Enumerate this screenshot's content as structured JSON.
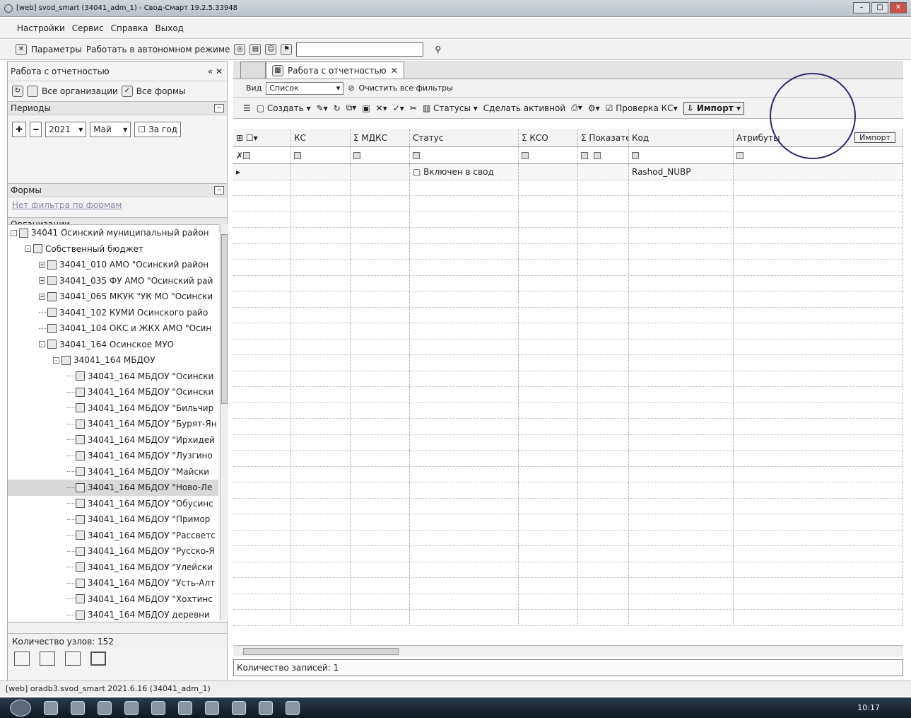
{
  "window": {
    "title": "[web] svod_smart (34041_adm_1) - Свод-Смарт 19.2.5.33948",
    "min": "–",
    "max": "□",
    "close": "✕"
  },
  "menu": [
    "Настройки",
    "Сервис",
    "Справка",
    "Выход"
  ],
  "toolbar": {
    "params": "Параметры",
    "offline": "Работать в автономном режиме",
    "search_icon": "binoculars-icon"
  },
  "left": {
    "title": "Работа с отчетностью",
    "close_marks": "« ✕",
    "all_orgs": "Все организации",
    "all_forms": "Все формы",
    "periods": "Периоды",
    "year": "2021",
    "month": "Май",
    "for_year": "За год",
    "forms": "Формы",
    "forms_filter": "Нет фильтра по формам",
    "orgs": "Организации",
    "tree": [
      {
        "level": 0,
        "exp": "-",
        "label": "34041 Осинский муниципальный район"
      },
      {
        "level": 1,
        "exp": "-",
        "label": "Собственный бюджет"
      },
      {
        "level": 2,
        "exp": "+",
        "label": "34041_010 АМО \"Осинский район"
      },
      {
        "level": 2,
        "exp": "+",
        "label": "34041_035 ФУ АМО \"Осинский рай"
      },
      {
        "level": 2,
        "exp": "+",
        "label": "34041_065 МКУК \"УК МО \"Осински"
      },
      {
        "level": 2,
        "exp": "",
        "label": "34041_102 КУМИ Осинского райо"
      },
      {
        "level": 2,
        "exp": "",
        "label": "34041_104 ОКС и ЖКХ АМО \"Осин"
      },
      {
        "level": 2,
        "exp": "-",
        "label": "34041_164 Осинское МУО"
      },
      {
        "level": 3,
        "exp": "-",
        "label": "34041_164 МБДОУ"
      },
      {
        "level": 4,
        "exp": "",
        "label": "34041_164 МБДОУ \"Осински"
      },
      {
        "level": 4,
        "exp": "",
        "label": "34041_164 МБДОУ \"Осински"
      },
      {
        "level": 4,
        "exp": "",
        "label": "34041_164 МБДОУ \"Бильчир"
      },
      {
        "level": 4,
        "exp": "",
        "label": "34041_164 МБДОУ \"Бурят-Ян"
      },
      {
        "level": 4,
        "exp": "",
        "label": "34041_164 МБДОУ \"Ирхидей"
      },
      {
        "level": 4,
        "exp": "",
        "label": "34041_164 МБДОУ \"Лузгино"
      },
      {
        "level": 4,
        "exp": "",
        "label": "34041_164 МБДОУ \"Майски"
      },
      {
        "level": 4,
        "exp": "",
        "label": "34041_164 МБДОУ \"Ново-Ле",
        "selected": true
      },
      {
        "level": 4,
        "exp": "",
        "label": "34041_164 МБДОУ \"Обусинс"
      },
      {
        "level": 4,
        "exp": "",
        "label": "34041_164 МБДОУ \"Примор"
      },
      {
        "level": 4,
        "exp": "",
        "label": "34041_164 МБДОУ \"Рассветс"
      },
      {
        "level": 4,
        "exp": "",
        "label": "34041_164 МБДОУ \"Русско-Я"
      },
      {
        "level": 4,
        "exp": "",
        "label": "34041_164 МБДОУ \"Улейски"
      },
      {
        "level": 4,
        "exp": "",
        "label": "34041_164 МБДОУ \"Усть-Алт"
      },
      {
        "level": 4,
        "exp": "",
        "label": "34041_164 МБДОУ \"Хохтинс"
      },
      {
        "level": 4,
        "exp": "",
        "label": "34041_164 МБДОУ деревни"
      }
    ],
    "node_count": "Количество узлов: 152"
  },
  "right": {
    "tab": "Работа с отчетностью",
    "view_label": "Вид",
    "view_value": "Список",
    "clear_filters": "Очистить все фильтры",
    "create": "Создать",
    "statuses": "Статусы",
    "make_active": "Сделать активной",
    "check_kc": "Проверка КС",
    "import": "Импорт",
    "import_tooltip": "Импорт",
    "columns": [
      "КС",
      "МДКС",
      "Статус",
      "КСО",
      "Показате",
      "Код",
      "Атрибуты"
    ],
    "row": {
      "status": "Включен в свод",
      "code": "Rashod_NUBP"
    },
    "record_count": "Количество записей: 1"
  },
  "statusbar": "[web] oradb3.svod_smart 2021.6.16 (34041_adm_1)",
  "clock": "10:17"
}
